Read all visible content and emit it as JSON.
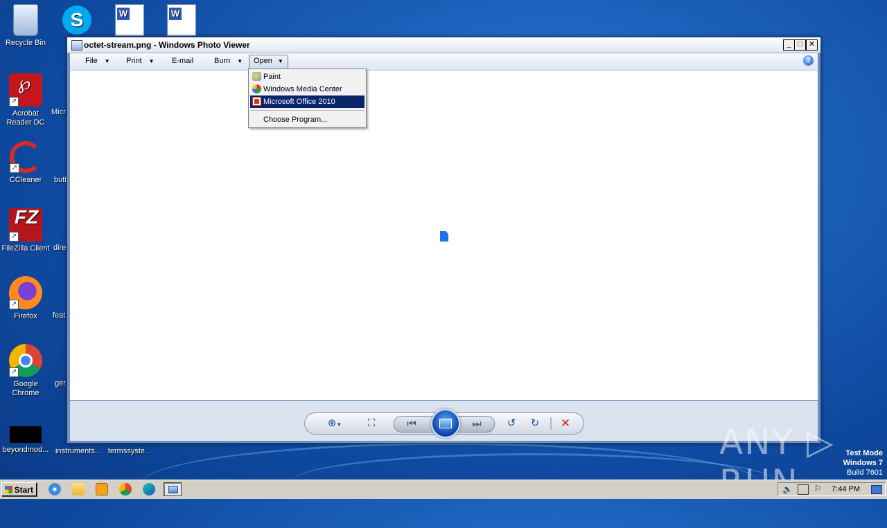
{
  "desktop": {
    "icons": [
      {
        "label": "Recycle Bin"
      },
      {
        "label": "Acrobat Reader DC"
      },
      {
        "label": "CCleaner"
      },
      {
        "label": "FileZilla Client"
      },
      {
        "label": "Firefox"
      },
      {
        "label": "Google Chrome"
      },
      {
        "label": "beyondmod..."
      }
    ],
    "partial_icons": [
      {
        "label": "Micr"
      },
      {
        "label": "butt"
      },
      {
        "label": "dire"
      },
      {
        "label": "feat"
      },
      {
        "label": "ger"
      },
      {
        "label": "instruments..."
      },
      {
        "label": "termssyste..."
      }
    ]
  },
  "window": {
    "title": "octet-stream.png - Windows Photo Viewer",
    "controls": {
      "minimize": "_",
      "maximize": "□",
      "close": "✕"
    },
    "menu": [
      {
        "label": "File",
        "has_arrow": true
      },
      {
        "label": "Print",
        "has_arrow": true
      },
      {
        "label": "E-mail",
        "has_arrow": false
      },
      {
        "label": "Burn",
        "has_arrow": true
      },
      {
        "label": "Open",
        "has_arrow": true
      }
    ],
    "help": "?",
    "open_menu": {
      "items": [
        {
          "label": "Paint",
          "icon": "paint-icon"
        },
        {
          "label": "Windows Media Center",
          "icon": "media-center-icon"
        },
        {
          "label": "Microsoft Office 2010",
          "icon": "office-icon",
          "selected": true
        }
      ],
      "choose": "Choose Program..."
    }
  },
  "taskbar": {
    "start": "Start",
    "clock": "7:44 PM"
  },
  "overlay": {
    "watermark": "ANY ▷ RUN",
    "test_mode": "Test Mode",
    "os": "Windows 7",
    "build": "Build 7601"
  }
}
